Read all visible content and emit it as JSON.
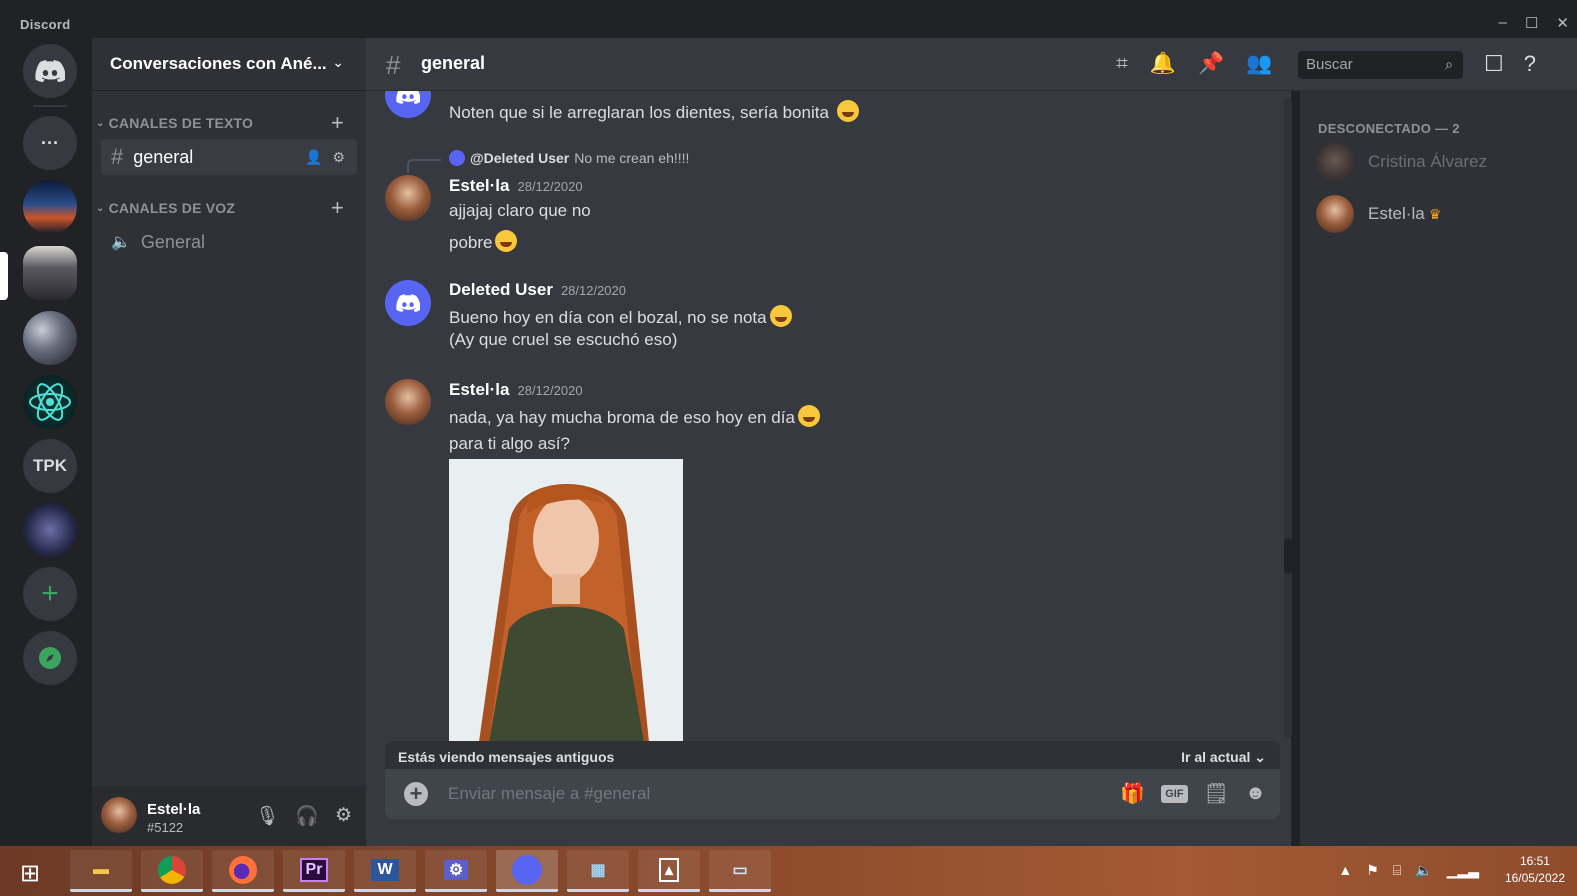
{
  "window": {
    "app_name": "Discord",
    "controls": [
      "–",
      "☐",
      "✕"
    ]
  },
  "servers": {
    "home_icon": "discord-logo-icon",
    "items": [
      {
        "type": "folder",
        "label": "···"
      },
      {
        "type": "image",
        "name": "server-image-1"
      },
      {
        "type": "image",
        "name": "server-image-2"
      },
      {
        "type": "image",
        "name": "server-image-3"
      },
      {
        "type": "image",
        "name": "server-image-4"
      },
      {
        "type": "text",
        "label": "TPK"
      },
      {
        "type": "image",
        "name": "server-image-5"
      }
    ],
    "add_label": "+",
    "explore_icon": "compass-icon"
  },
  "sidebar": {
    "guild_name": "Conversaciones con Ané...",
    "categories": [
      {
        "label": "CANALES DE TEXTO",
        "plus": "+"
      },
      {
        "label": "CANALES DE VOZ",
        "plus": "+"
      }
    ],
    "channels": [
      {
        "label": "general",
        "type": "text",
        "active": true
      },
      {
        "label": "General",
        "type": "voice",
        "active": false
      }
    ],
    "user": {
      "name": "Estel·la",
      "tag": "#5122"
    }
  },
  "chat": {
    "channel_name": "general",
    "search_placeholder": "Buscar",
    "messages": [
      {
        "text": "Noten que si le arreglaran los dientes, sería bonita"
      },
      {
        "reply_author": "@Deleted User",
        "reply_text": "No me crean eh!!!!",
        "author": "Estel·la",
        "timestamp": "28/12/2020",
        "lines": [
          "ajjajaj claro que no",
          "pobre"
        ]
      },
      {
        "author": "Deleted User",
        "timestamp": "28/12/2020",
        "lines": [
          "Bueno hoy en día con el bozal, no se nota",
          "(Ay que cruel se escuchó eso)"
        ]
      },
      {
        "author": "Estel·la",
        "timestamp": "28/12/2020",
        "lines": [
          "nada, ya hay mucha broma de eso hoy en día",
          "para ti algo así?"
        ]
      }
    ],
    "old_messages_notice": "Estás viendo mensajes antiguos",
    "jump_label": "Ir al actual",
    "composer_placeholder": "Enviar mensaje a #general",
    "composer_tools": {
      "gif": "GIF"
    }
  },
  "members": {
    "category": "DESCONECTADO — 2",
    "list": [
      {
        "name": "Cristina Álvarez",
        "owner": false
      },
      {
        "name": "Estel·la",
        "owner": true
      }
    ]
  },
  "taskbar": {
    "apps": [
      "file-explorer",
      "chrome",
      "firefox",
      "premiere",
      "word",
      "settings",
      "discord",
      "control-panel",
      "photos",
      "monitor"
    ],
    "premiere_label": "Pr",
    "word_label": "W",
    "clock_time": "16:51",
    "clock_date": "16/05/2022"
  },
  "colors": {
    "blurple": "#5865f2",
    "green": "#3ba55d",
    "crown": "#faa61a",
    "bg_chat": "#36393f",
    "bg_sidebar": "#2f3136",
    "bg_rail": "#202225"
  }
}
